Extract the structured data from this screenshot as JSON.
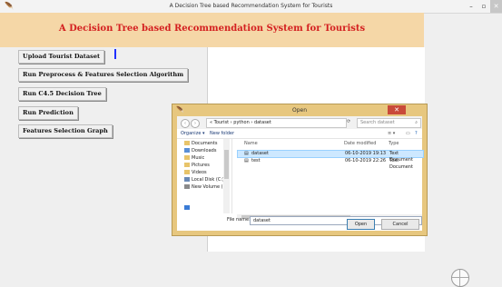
{
  "window": {
    "title": "A Decision Tree based Recommendation System for Tourists",
    "app_icon": "feather-icon",
    "controls": [
      "–",
      "▫",
      "✕"
    ]
  },
  "banner": {
    "heading": "A Decision Tree based Recommendation System for Tourists"
  },
  "buttons": {
    "upload": "Upload Tourist Dataset",
    "preprocess": "Run Preprocess & Features Selection Algorithm",
    "c45": "Run C4.5 Decision Tree",
    "predict": "Run Prediction",
    "graph": "Features Selection Graph"
  },
  "dialog": {
    "title": "Open",
    "close": "✕",
    "address": "« Tourist  ›  python  ›  dataset",
    "search_placeholder": "Search dataset",
    "toolbar": {
      "organize": "Organize ▾",
      "new_folder": "New folder"
    },
    "tree": [
      "Documents",
      "Downloads",
      "Music",
      "Pictures",
      "Videos",
      "Local Disk (C:)",
      "New Volume (D:)"
    ],
    "columns": {
      "name": "Name",
      "date": "Date modified",
      "type": "Type"
    },
    "files": [
      {
        "name": "dataset",
        "date": "06-10-2019 19:13",
        "type": "Text Document"
      },
      {
        "name": "test",
        "date": "06-10-2019 22:26",
        "type": "Text Document"
      }
    ],
    "file_name_label": "File name:",
    "file_name_value": "dataset",
    "open_button": "Open",
    "cancel_button": "Cancel"
  },
  "colors": {
    "banner": "#f5d7a7",
    "heading": "#d42020",
    "dialog_frame": "#e7c77f",
    "selection": "#cde8ff"
  }
}
